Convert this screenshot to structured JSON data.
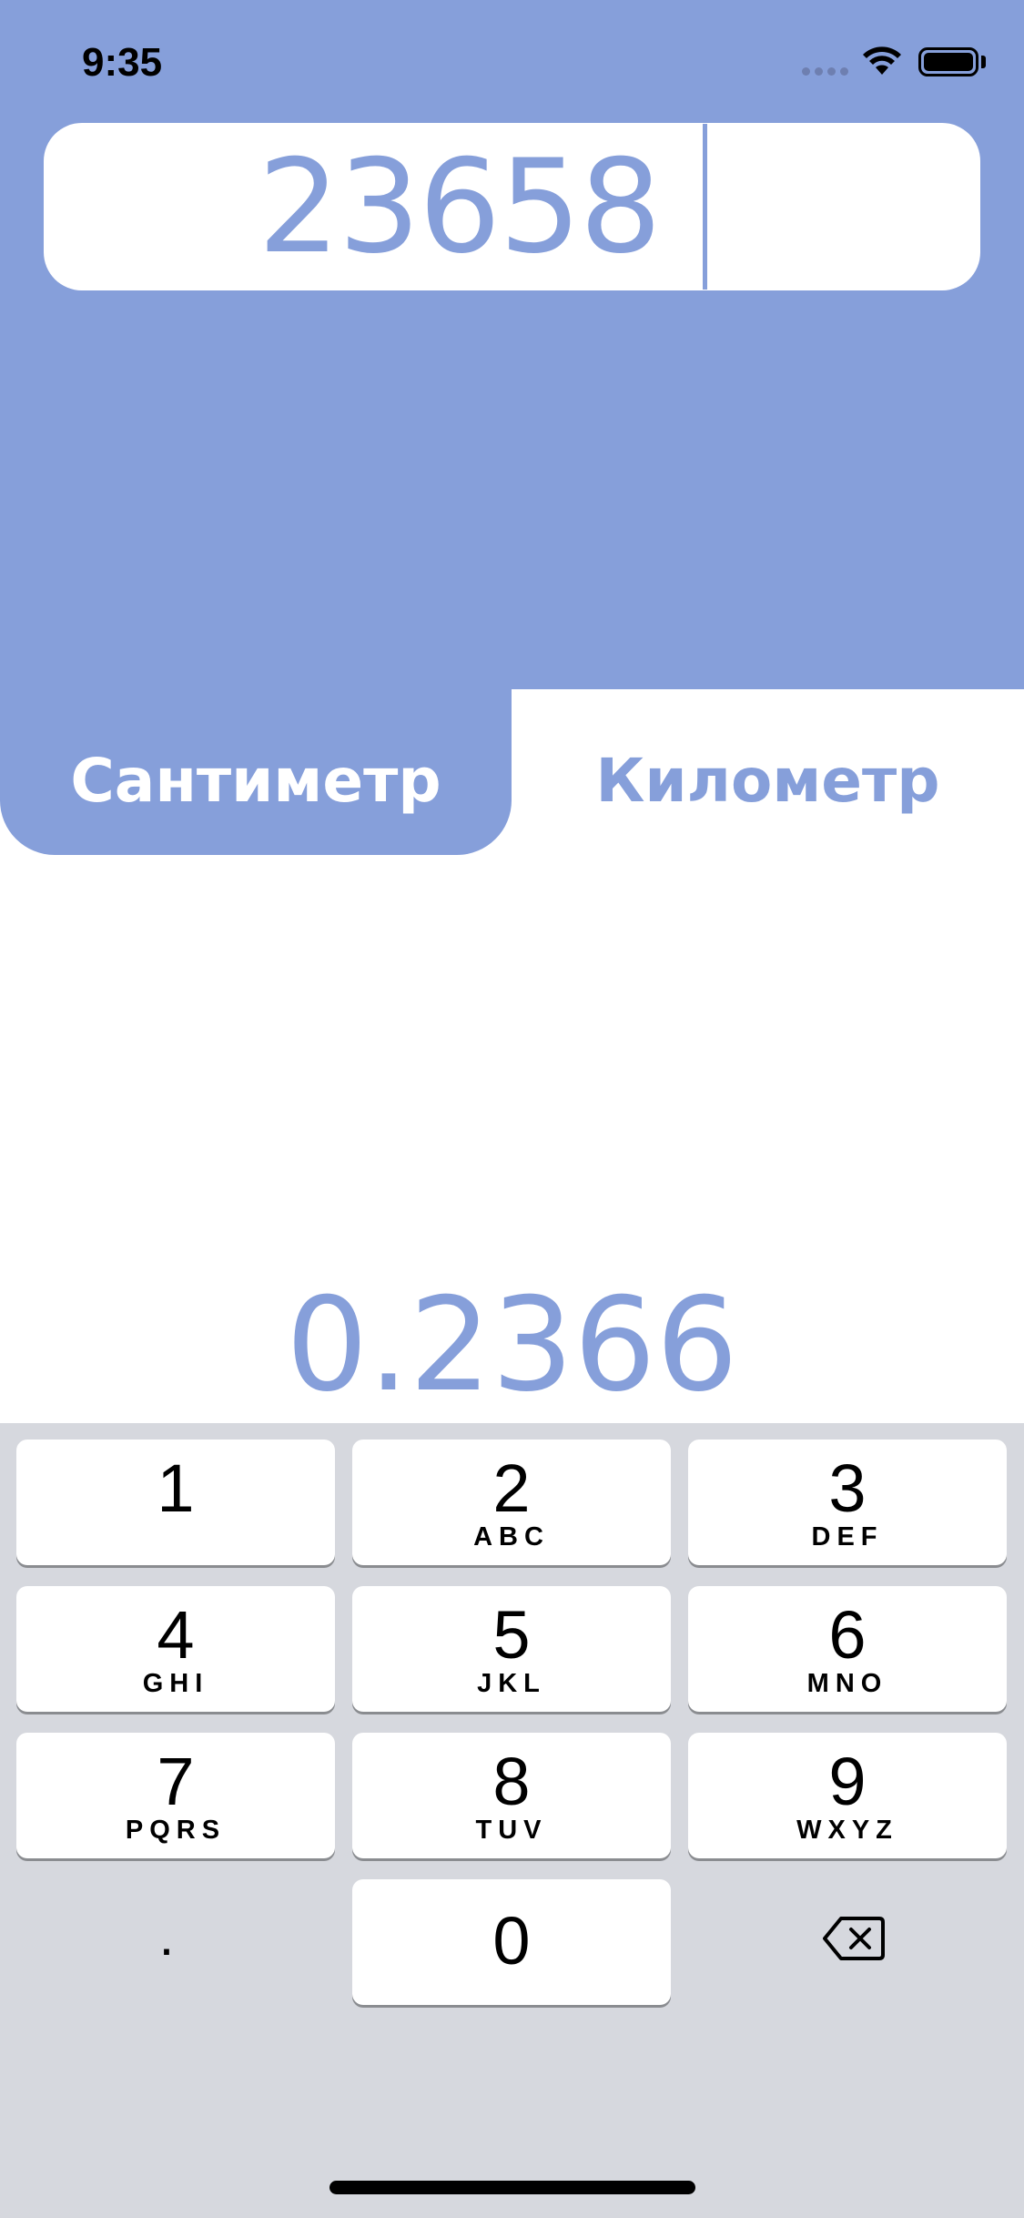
{
  "status_bar": {
    "time": "9:35",
    "icons": [
      "cellular-signal-icon",
      "wifi-icon",
      "battery-icon"
    ]
  },
  "converter": {
    "input_value": "23658",
    "result_value": "0.2366",
    "units": {
      "from": "Сантиметр",
      "to": "Километр"
    }
  },
  "keyboard": {
    "keys": [
      {
        "digit": "1",
        "letters": ""
      },
      {
        "digit": "2",
        "letters": "ABC"
      },
      {
        "digit": "3",
        "letters": "DEF"
      },
      {
        "digit": "4",
        "letters": "GHI"
      },
      {
        "digit": "5",
        "letters": "JKL"
      },
      {
        "digit": "6",
        "letters": "MNO"
      },
      {
        "digit": "7",
        "letters": "PQRS"
      },
      {
        "digit": "8",
        "letters": "TUV"
      },
      {
        "digit": "9",
        "letters": "WXYZ"
      }
    ],
    "dot_label": ".",
    "zero_label": "0",
    "backspace_icon": "backspace-icon"
  },
  "colors": {
    "accent": "#869fda",
    "keyboard_bg": "#d6d8de",
    "key_bg": "#ffffff"
  }
}
